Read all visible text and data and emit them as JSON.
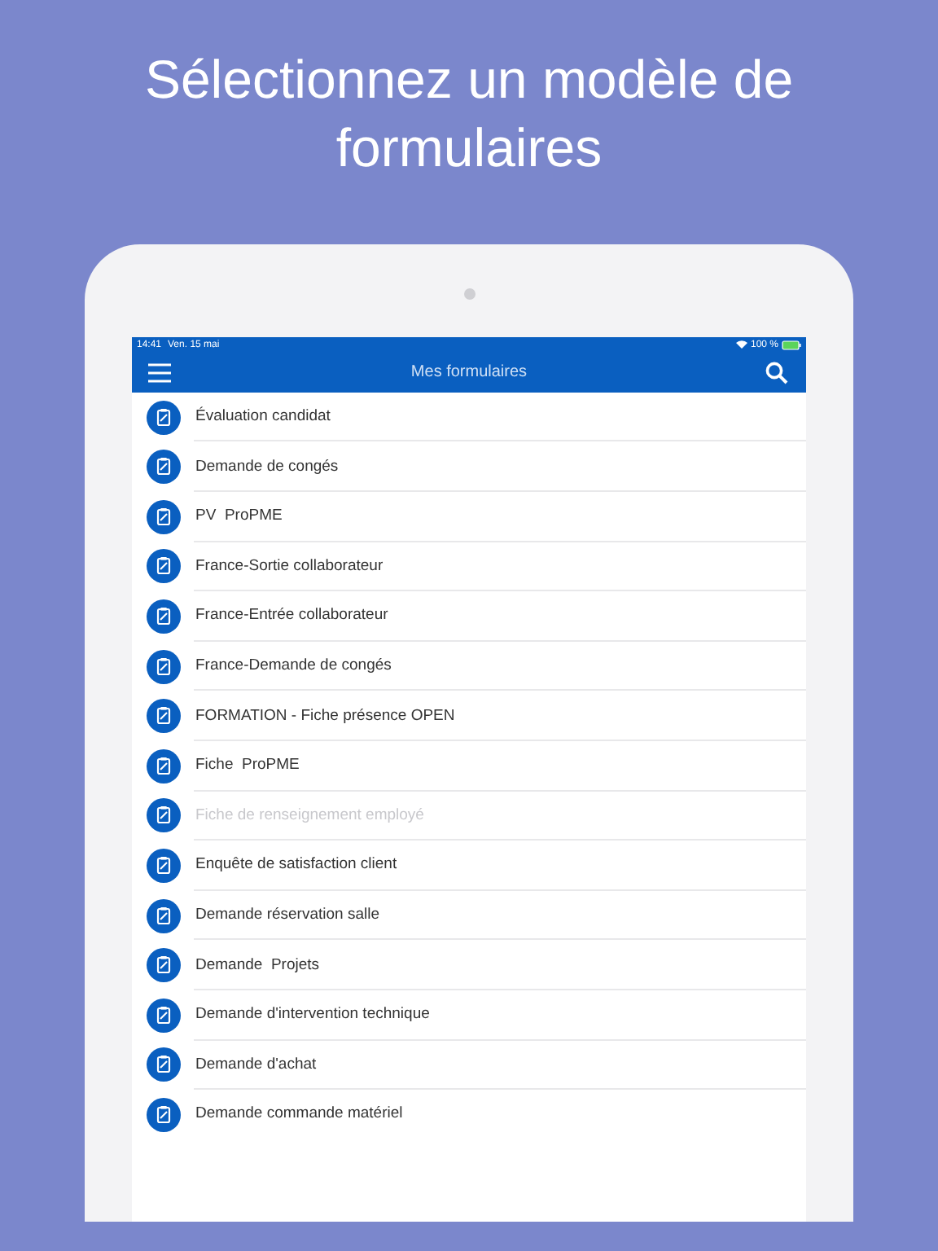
{
  "headline": "Sélectionnez un modèle de formulaires",
  "status_bar": {
    "time": "14:41",
    "date": "Ven. 15 mai",
    "battery": "100 %"
  },
  "nav_bar": {
    "title": "Mes formulaires"
  },
  "forms": [
    {
      "label": "Évaluation candidat",
      "disabled": false
    },
    {
      "label": "Demande de congés",
      "disabled": false
    },
    {
      "label": "PV  ProPME",
      "disabled": false
    },
    {
      "label": "France-Sortie collaborateur",
      "disabled": false
    },
    {
      "label": "France-Entrée collaborateur",
      "disabled": false
    },
    {
      "label": "France-Demande de congés",
      "disabled": false
    },
    {
      "label": "FORMATION - Fiche présence OPEN",
      "disabled": false
    },
    {
      "label": "Fiche  ProPME",
      "disabled": false
    },
    {
      "label": "Fiche de renseignement employé",
      "disabled": true
    },
    {
      "label": "Enquête de satisfaction client",
      "disabled": false
    },
    {
      "label": "Demande réservation salle",
      "disabled": false
    },
    {
      "label": "Demande  Projets",
      "disabled": false
    },
    {
      "label": "Demande d'intervention technique",
      "disabled": false
    },
    {
      "label": "Demande d'achat",
      "disabled": false
    },
    {
      "label": "Demande commande matériel",
      "disabled": false
    }
  ]
}
